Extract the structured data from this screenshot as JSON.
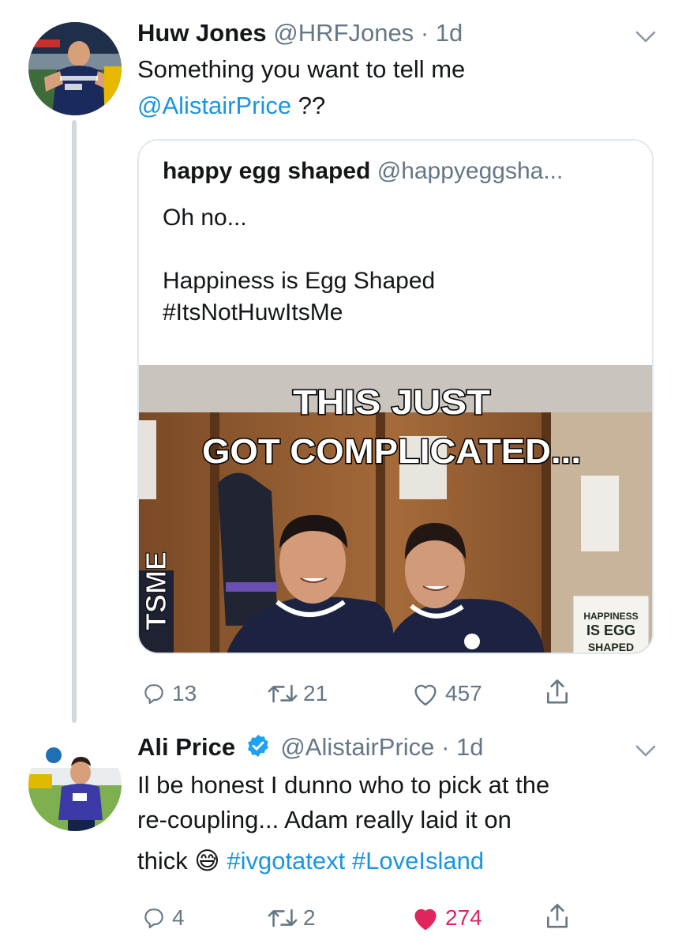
{
  "tweet1": {
    "name": "Huw Jones",
    "handle": "@HRFJones",
    "dot": "·",
    "time": "1d",
    "text_line1": "Something you want to tell me",
    "mention": "@AlistairPrice",
    "text_after_mention": " ??",
    "quote": {
      "name": "happy egg shaped",
      "handle": "@happyeggsha...",
      "line1": "Oh no...",
      "line2": "",
      "line3": "Happiness is Egg Shaped",
      "line4": "#ItsNotHuwItsMe",
      "image": {
        "caption_line1": "THIS JUST",
        "caption_line2": "GOT COMPLICATED...",
        "side_text": "TSME",
        "sign_line1": "HAPPINESS",
        "sign_line2": "IS EGG",
        "sign_line3": "SHAPED"
      }
    },
    "actions": {
      "replies": "13",
      "retweets": "21",
      "likes": "457"
    }
  },
  "tweet2": {
    "name": "Ali Price",
    "verified": true,
    "handle": "@AlistairPrice",
    "dot": "·",
    "time": "1d",
    "text_line1": "Il be honest I dunno who to pick at the",
    "text_line2": "re-coupling... Adam really laid it on",
    "text_line3_start": "thick",
    "emoji": "😅",
    "hashtag1": "#ivgotatext",
    "hashtag2": "#LoveIsland",
    "actions": {
      "replies": "4",
      "retweets": "2",
      "likes": "274",
      "liked": true
    }
  },
  "colors": {
    "link": "#1b95e0",
    "muted": "#657786",
    "like": "#e0245e",
    "verified": "#1da1f2",
    "border": "#e1e8ed"
  },
  "icons": [
    "chevron-down-icon",
    "reply-icon",
    "retweet-icon",
    "like-icon",
    "share-icon",
    "verified-badge-icon"
  ]
}
